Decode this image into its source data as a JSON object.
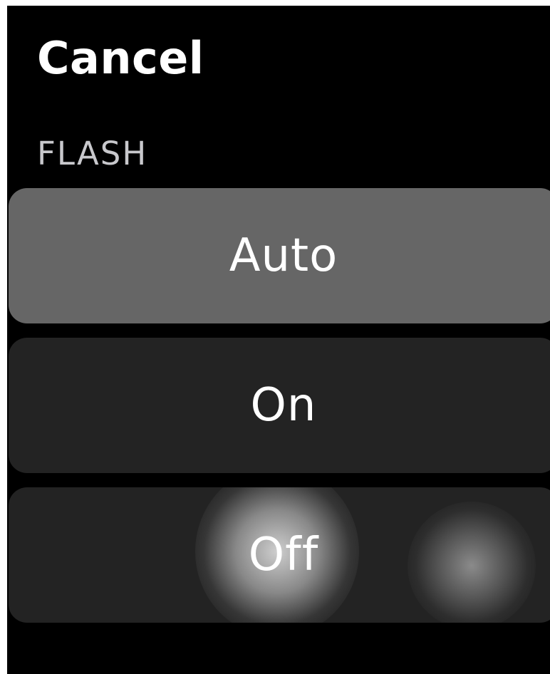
{
  "header": {
    "cancel_label": "Cancel"
  },
  "section": {
    "title": "FLASH"
  },
  "options": [
    {
      "label": "Auto",
      "selected": true
    },
    {
      "label": "On",
      "selected": false
    },
    {
      "label": "Off",
      "selected": false
    }
  ],
  "colors": {
    "background": "#000000",
    "selected_option": "#666666",
    "option": "#232323",
    "text": "#ffffff",
    "section_label": "#c8c8cc"
  }
}
